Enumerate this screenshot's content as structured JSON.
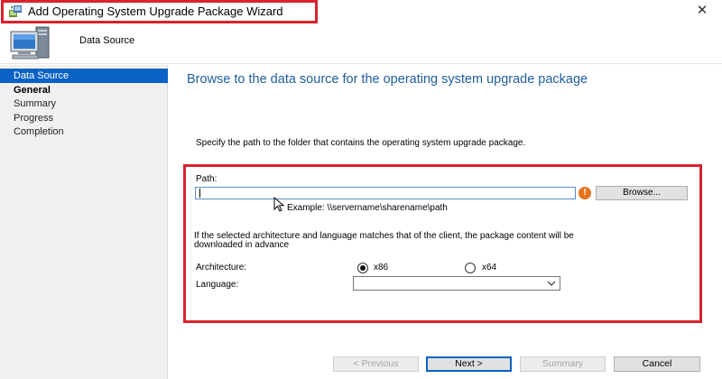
{
  "window": {
    "title": "Add Operating System Upgrade Package Wizard",
    "close_glyph": "✕",
    "icon": "wizard-app-icon"
  },
  "header": {
    "title": "Data Source",
    "icon": "computer-icon"
  },
  "sidebar": {
    "items": [
      {
        "label": "Data Source",
        "state": "active"
      },
      {
        "label": "General",
        "state": "bold"
      },
      {
        "label": "Summary",
        "state": "normal"
      },
      {
        "label": "Progress",
        "state": "normal"
      },
      {
        "label": "Completion",
        "state": "normal"
      }
    ]
  },
  "main": {
    "heading": "Browse to the data source for the operating system upgrade package",
    "description": "Specify the path to the folder that contains the operating system upgrade package.",
    "path": {
      "label": "Path:",
      "value": "",
      "example": "Example: \\\\servername\\sharename\\path",
      "browse_label": "Browse..."
    },
    "note_line1": "If the selected architecture and language matches that of the client, the package content will be",
    "note_line2": "downloaded in advance",
    "architecture": {
      "label": "Architecture:",
      "options": [
        "x86",
        "x64"
      ],
      "selected": "x86"
    },
    "language": {
      "label": "Language:",
      "value": ""
    }
  },
  "footer": {
    "previous_label": "< Previous",
    "next_label": "Next >",
    "summary_label": "Summary",
    "cancel_label": "Cancel"
  },
  "colors": {
    "accent": "#0b62c4",
    "heading": "#1f5d9e",
    "highlight": "#d9232e",
    "warning": "#e5741c"
  }
}
